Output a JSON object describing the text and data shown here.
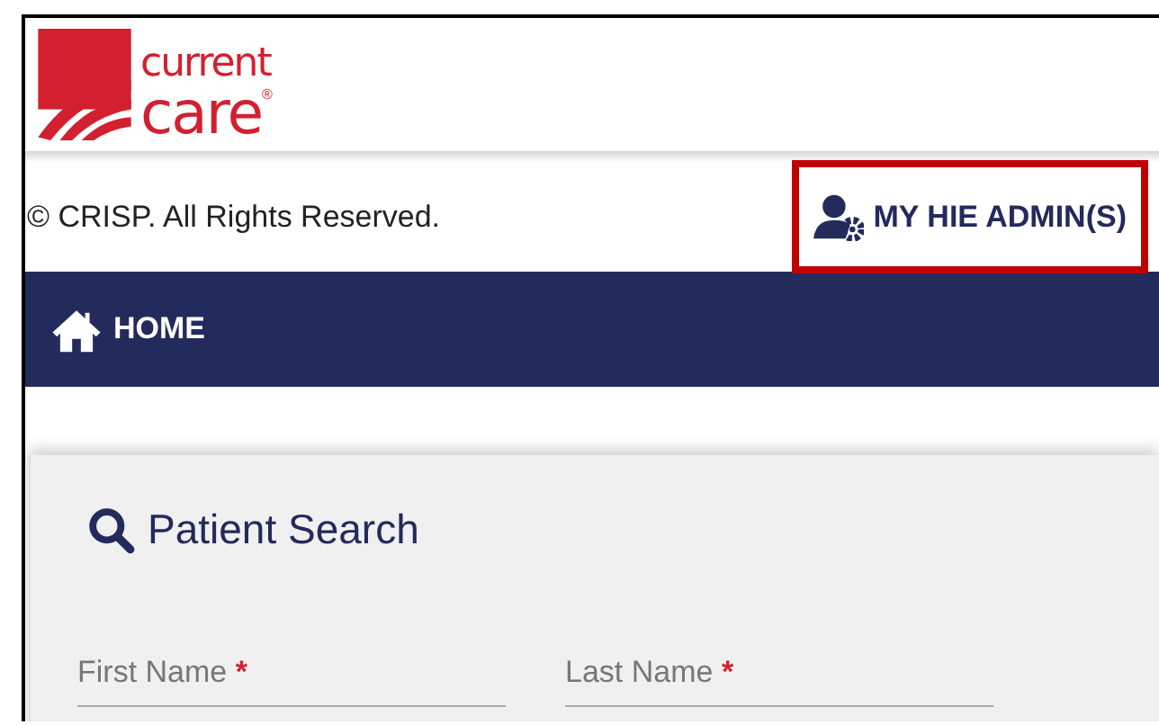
{
  "logo": {
    "line1": "current",
    "line2": "care",
    "mark": "®"
  },
  "footer": {
    "copyright": "© CRISP. All Rights Reserved.",
    "admin_link": {
      "label": "MY HIE ADMIN(S)",
      "highlighted": true
    }
  },
  "nav": {
    "items": [
      {
        "label": "HOME"
      }
    ]
  },
  "search_panel": {
    "title": "Patient Search",
    "fields": [
      {
        "label": "First Name",
        "required_mark": "*"
      },
      {
        "label": "Last Name",
        "required_mark": "*"
      }
    ]
  }
}
